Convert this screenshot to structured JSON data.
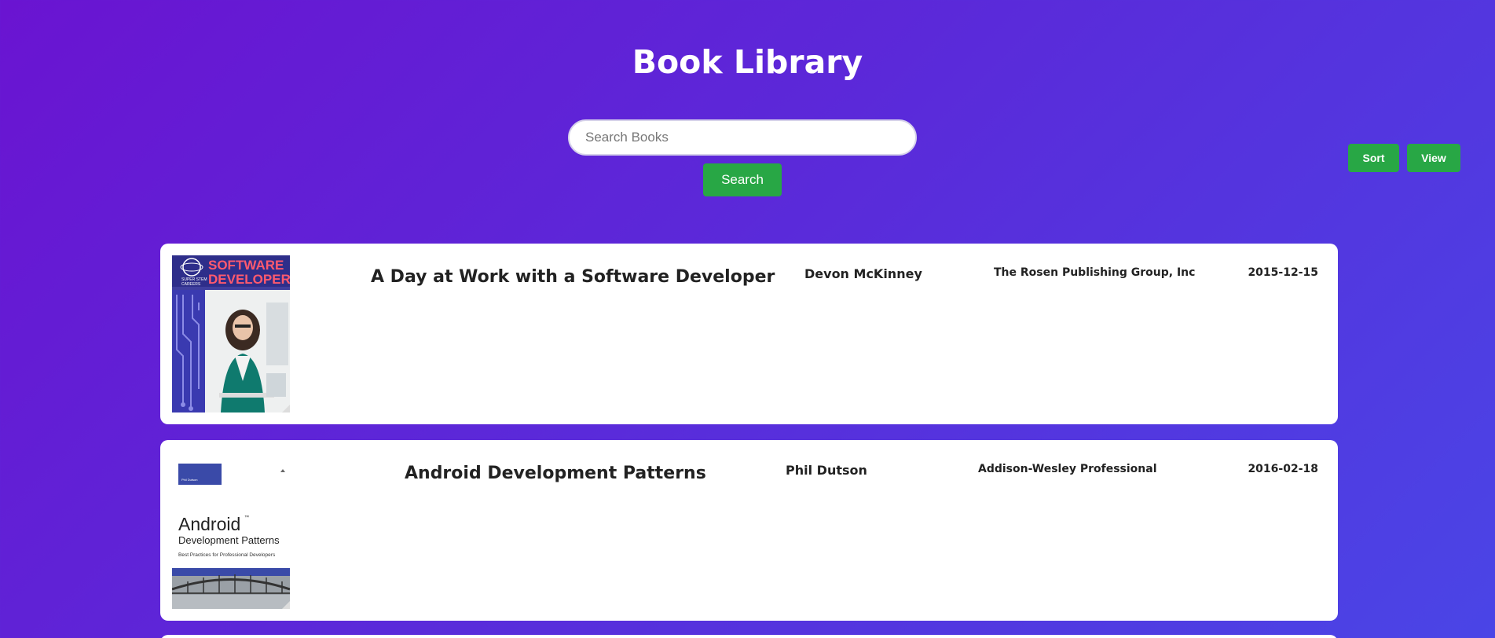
{
  "header": {
    "title": "Book Library"
  },
  "search": {
    "placeholder": "Search Books",
    "value": "",
    "button_label": "Search"
  },
  "toolbar": {
    "sort_label": "Sort",
    "view_label": "View"
  },
  "colors": {
    "accent_green": "#28a745",
    "background_start": "#6a14d1",
    "background_end": "#4a45e6"
  },
  "books": [
    {
      "title": "A Day at Work with a Software Developer",
      "author": "Devon McKinney",
      "publisher": "The Rosen Publishing Group, Inc",
      "date": "2015-12-15",
      "cover": {
        "line1": "SOFTWARE",
        "line2": "DEVELOPER",
        "series_a": "SUPER STEM",
        "series_b": "CAREERS"
      }
    },
    {
      "title": "Android Development Patterns",
      "author": "Phil Dutson",
      "publisher": "Addison-Wesley Professional",
      "date": "2016-02-18",
      "cover": {
        "brand": "Phil Dutson",
        "name": "Android",
        "trademark": "™",
        "subtitle": "Development Patterns",
        "tagline": "Best Practices for Professional Developers"
      }
    }
  ]
}
